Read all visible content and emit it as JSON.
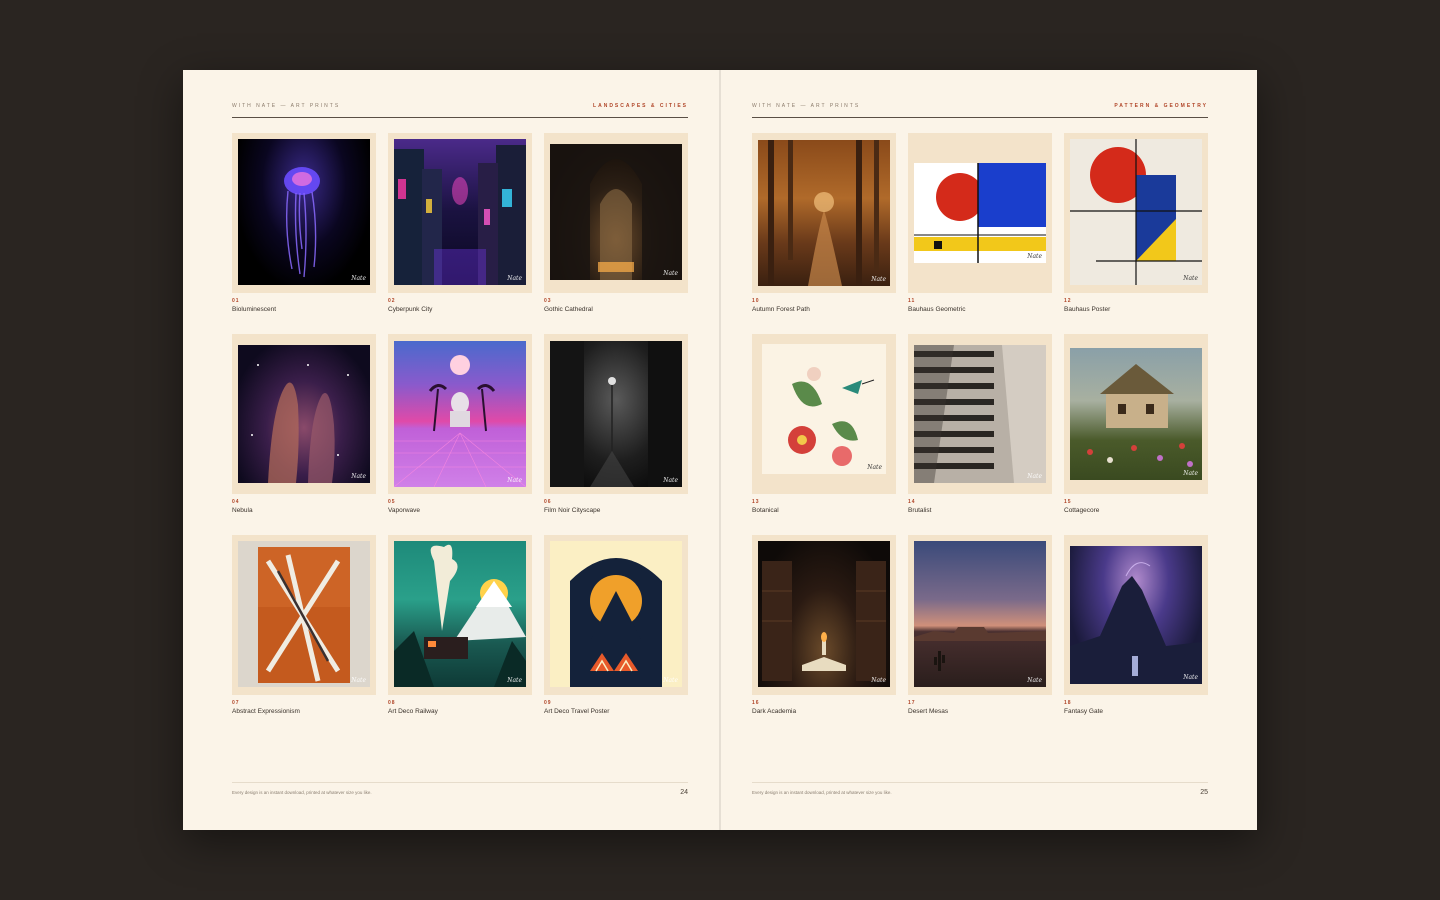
{
  "brand": "With Nate — Art Prints",
  "signature": "Nate",
  "footer_note": "Every design is an instant download, printed at whatever size you like.",
  "left_page": {
    "section": "Landscapes & Cities",
    "page_number": "24",
    "prints": [
      {
        "num": "01",
        "title": "Bioluminescent"
      },
      {
        "num": "02",
        "title": "Cyberpunk City"
      },
      {
        "num": "03",
        "title": "Gothic Cathedral"
      },
      {
        "num": "04",
        "title": "Nebula"
      },
      {
        "num": "05",
        "title": "Vaporwave"
      },
      {
        "num": "06",
        "title": "Film Noir Cityscape"
      },
      {
        "num": "07",
        "title": "Abstract Expressionism"
      },
      {
        "num": "08",
        "title": "Art Deco Railway"
      },
      {
        "num": "09",
        "title": "Art Deco Travel Poster"
      }
    ]
  },
  "right_page": {
    "section": "Pattern & Geometry",
    "page_number": "25",
    "prints": [
      {
        "num": "10",
        "title": "Autumn Forest Path"
      },
      {
        "num": "11",
        "title": "Bauhaus Geometric"
      },
      {
        "num": "12",
        "title": "Bauhaus Poster"
      },
      {
        "num": "13",
        "title": "Botanical"
      },
      {
        "num": "14",
        "title": "Brutalist"
      },
      {
        "num": "15",
        "title": "Cottagecore"
      },
      {
        "num": "16",
        "title": "Dark Academia"
      },
      {
        "num": "17",
        "title": "Desert Mesas"
      },
      {
        "num": "18",
        "title": "Fantasy Gate"
      }
    ]
  },
  "colors": {
    "background": "#2a2521",
    "paper": "#fbf4e8",
    "accent": "#b04528",
    "mat": "#f3e3ca"
  }
}
